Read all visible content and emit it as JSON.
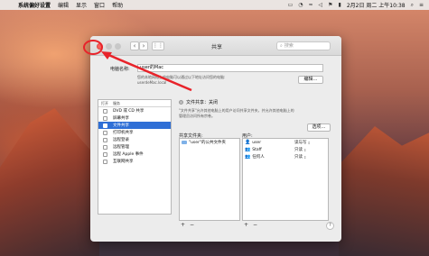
{
  "menubar": {
    "apple_icon": "apple-icon",
    "items": [
      "系统偏好设置",
      "编辑",
      "显示",
      "窗口",
      "帮助"
    ],
    "status": {
      "datetime": "2月2日 周二 上午10:38",
      "icons": [
        "airplay-icon",
        "clock-icon",
        "wifi-icon",
        "volume-icon",
        "flag-icon",
        "battery-icon",
        "spotlight-icon",
        "menu-icon"
      ]
    }
  },
  "window": {
    "title": "共享",
    "search_placeholder": "搜索",
    "computer_name_label": "电脑名称:",
    "computer_name_value": "user的Mac",
    "description_line1": "您的本地网络上的电脑可以通过以下地址访问您的电脑:",
    "description_line2": "userdeMac.local",
    "edit_button": "编辑…",
    "services_header": {
      "on": "打开",
      "service": "服务"
    },
    "services": [
      {
        "label": "DVD 或 CD 共享",
        "checked": false,
        "selected": false
      },
      {
        "label": "屏幕共享",
        "checked": false,
        "selected": false
      },
      {
        "label": "文件共享",
        "checked": false,
        "selected": true
      },
      {
        "label": "打印机共享",
        "checked": false,
        "selected": false
      },
      {
        "label": "远程登录",
        "checked": false,
        "selected": false
      },
      {
        "label": "远程管理",
        "checked": false,
        "selected": false
      },
      {
        "label": "远程 Apple 事件",
        "checked": false,
        "selected": false
      },
      {
        "label": "互联网共享",
        "checked": false,
        "selected": false
      }
    ],
    "file_sharing_status": "文件共享：关闭",
    "file_sharing_desc_1": "\"文件共享\"允许其他电脑上的用户访问共享文件夹，并允许其他电脑上的",
    "file_sharing_desc_2": "管理员访问所有宗卷。",
    "options_button": "选项…",
    "shared_folders_label": "共享文件夹:",
    "shared_folders": [
      "\"user\"的公共文件夹"
    ],
    "users_label": "用户:",
    "users": [
      {
        "name": "user",
        "perm": "读与写"
      },
      {
        "name": "Staff",
        "perm": "只读"
      },
      {
        "name": "任何人",
        "perm": "只读"
      }
    ],
    "add_label": "+",
    "remove_label": "−",
    "help_label": "?"
  },
  "colors": {
    "selection": "#2f6fd6",
    "annotation": "#e8232a",
    "close": "#fc605c"
  }
}
